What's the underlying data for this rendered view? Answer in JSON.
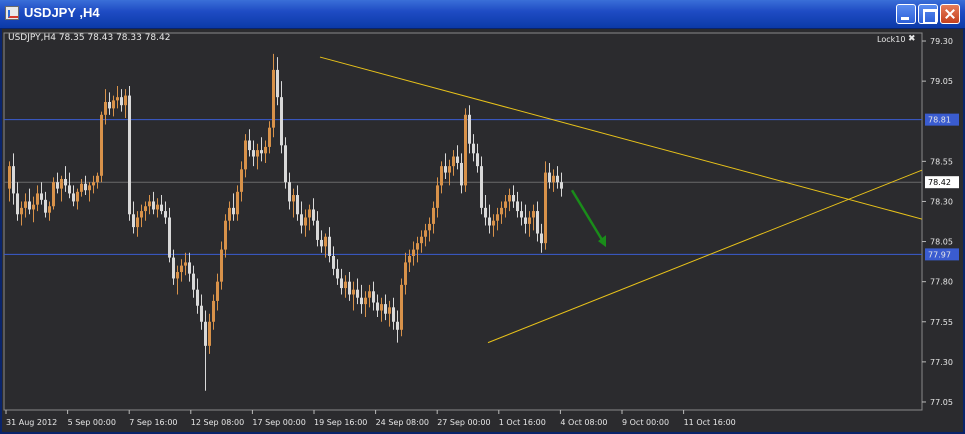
{
  "window": {
    "title": "USDJPY ,H4"
  },
  "chart_header": {
    "symbol_info": "USDJPY,H4  78.35 78.43 78.33 78.42",
    "lock_label": "Lock10",
    "lock_close_glyph": "✖"
  },
  "colors": {
    "background": "#2b2b2e",
    "grid": "#555560",
    "bull_candle": "#d8924a",
    "bear_candle": "#d9d9d9",
    "trendline": "#e8c21a",
    "hline": "#3a5cd0",
    "arrow": "#1a8c1a",
    "price_tag_bg": "#ffffff"
  },
  "chart_data": {
    "type": "candlestick",
    "symbol": "USDJPY",
    "timeframe": "H4",
    "ylim": [
      77.0,
      79.35
    ],
    "y_ticks": [
      "79.30",
      "79.05",
      "78.55",
      "78.30",
      "78.05",
      "77.80",
      "77.55",
      "77.30",
      "77.05"
    ],
    "x_tick_labels": [
      "31 Aug 2012",
      "5 Sep 00:00",
      "7 Sep 16:00",
      "12 Sep 08:00",
      "17 Sep 00:00",
      "19 Sep 16:00",
      "24 Sep 08:00",
      "27 Sep 00:00",
      "1 Oct 16:00",
      "4 Oct 08:00",
      "9 Oct 00:00",
      "11 Oct 16:00"
    ],
    "horizontal_lines": [
      {
        "price": 78.81,
        "label": "78.81"
      },
      {
        "price": 77.97,
        "label": "77.97"
      }
    ],
    "current_price": {
      "price": 78.42,
      "label": "78.42"
    },
    "trendlines": [
      {
        "name": "upper",
        "from": {
          "bar": 78,
          "price": 79.2
        },
        "to": {
          "bar": 230,
          "price": 78.18
        }
      },
      {
        "name": "lower",
        "from": {
          "bar": 120,
          "price": 77.42
        },
        "to": {
          "bar": 230,
          "price": 78.51
        }
      }
    ],
    "bars_count": 183,
    "bars_per_label": 15.4,
    "candles": [
      [
        78.38,
        78.55,
        78.3,
        78.52
      ],
      [
        78.52,
        78.6,
        78.28,
        78.35
      ],
      [
        78.35,
        78.42,
        78.18,
        78.22
      ],
      [
        78.22,
        78.3,
        78.15,
        78.26
      ],
      [
        78.26,
        78.35,
        78.2,
        78.3
      ],
      [
        78.3,
        78.38,
        78.22,
        78.25
      ],
      [
        78.25,
        78.33,
        78.17,
        78.28
      ],
      [
        78.28,
        78.4,
        78.24,
        78.35
      ],
      [
        78.35,
        78.42,
        78.28,
        78.31
      ],
      [
        78.31,
        78.36,
        78.2,
        78.23
      ],
      [
        78.23,
        78.3,
        78.18,
        78.27
      ],
      [
        78.27,
        78.45,
        78.25,
        78.42
      ],
      [
        78.42,
        78.48,
        78.35,
        78.38
      ],
      [
        78.38,
        78.46,
        78.3,
        78.44
      ],
      [
        78.44,
        78.52,
        78.36,
        78.4
      ],
      [
        78.4,
        78.48,
        78.32,
        78.35
      ],
      [
        78.35,
        78.4,
        78.27,
        78.3
      ],
      [
        78.3,
        78.38,
        78.25,
        78.36
      ],
      [
        78.36,
        78.44,
        78.33,
        78.41
      ],
      [
        78.41,
        78.46,
        78.34,
        78.37
      ],
      [
        78.37,
        78.42,
        78.3,
        78.4
      ],
      [
        78.4,
        78.46,
        78.35,
        78.42
      ],
      [
        78.42,
        78.48,
        78.38,
        78.46
      ],
      [
        78.46,
        78.86,
        78.42,
        78.84
      ],
      [
        78.84,
        79.0,
        78.78,
        78.92
      ],
      [
        78.92,
        78.98,
        78.84,
        78.88
      ],
      [
        78.88,
        78.96,
        78.83,
        78.93
      ],
      [
        78.93,
        79.02,
        78.88,
        78.95
      ],
      [
        78.95,
        79.0,
        78.86,
        78.9
      ],
      [
        78.9,
        79.0,
        78.82,
        78.96
      ],
      [
        78.96,
        79.02,
        78.18,
        78.22
      ],
      [
        78.22,
        78.3,
        78.1,
        78.14
      ],
      [
        78.14,
        78.24,
        78.08,
        78.2
      ],
      [
        78.2,
        78.28,
        78.14,
        78.24
      ],
      [
        78.24,
        78.3,
        78.18,
        78.27
      ],
      [
        78.27,
        78.34,
        78.22,
        78.3
      ],
      [
        78.3,
        78.36,
        78.22,
        78.25
      ],
      [
        78.25,
        78.32,
        78.2,
        78.28
      ],
      [
        78.28,
        78.34,
        78.22,
        78.24
      ],
      [
        78.24,
        78.3,
        78.16,
        78.2
      ],
      [
        78.2,
        78.26,
        77.92,
        77.95
      ],
      [
        77.95,
        78.0,
        77.78,
        77.82
      ],
      [
        77.82,
        77.9,
        77.72,
        77.86
      ],
      [
        77.86,
        77.94,
        77.8,
        77.9
      ],
      [
        77.9,
        77.98,
        77.84,
        77.92
      ],
      [
        77.92,
        77.98,
        77.8,
        77.85
      ],
      [
        77.85,
        77.9,
        77.7,
        77.75
      ],
      [
        77.75,
        77.82,
        77.6,
        77.65
      ],
      [
        77.65,
        77.72,
        77.5,
        77.55
      ],
      [
        77.55,
        77.62,
        77.12,
        77.4
      ],
      [
        77.4,
        77.6,
        77.35,
        77.55
      ],
      [
        77.55,
        77.72,
        77.5,
        77.68
      ],
      [
        77.68,
        77.85,
        77.62,
        77.8
      ],
      [
        77.8,
        78.05,
        77.75,
        78.0
      ],
      [
        78.0,
        78.22,
        77.95,
        78.18
      ],
      [
        78.18,
        78.3,
        78.12,
        78.26
      ],
      [
        78.26,
        78.35,
        78.18,
        78.22
      ],
      [
        78.22,
        78.4,
        78.18,
        78.36
      ],
      [
        78.36,
        78.55,
        78.3,
        78.5
      ],
      [
        78.5,
        78.72,
        78.45,
        78.68
      ],
      [
        78.68,
        78.75,
        78.58,
        78.62
      ],
      [
        78.62,
        78.68,
        78.52,
        78.58
      ],
      [
        78.58,
        78.66,
        78.5,
        78.62
      ],
      [
        78.62,
        78.7,
        78.55,
        78.6
      ],
      [
        78.6,
        78.68,
        78.54,
        78.64
      ],
      [
        78.64,
        78.8,
        78.6,
        78.76
      ],
      [
        78.76,
        79.22,
        78.7,
        79.12
      ],
      [
        79.12,
        79.2,
        78.9,
        78.95
      ],
      [
        78.95,
        79.05,
        78.6,
        78.65
      ],
      [
        78.65,
        78.7,
        78.38,
        78.42
      ],
      [
        78.42,
        78.48,
        78.25,
        78.3
      ],
      [
        78.3,
        78.38,
        78.2,
        78.34
      ],
      [
        78.34,
        78.4,
        78.18,
        78.22
      ],
      [
        78.22,
        78.3,
        78.1,
        78.15
      ],
      [
        78.15,
        78.25,
        78.08,
        78.2
      ],
      [
        78.2,
        78.28,
        78.12,
        78.25
      ],
      [
        78.25,
        78.32,
        78.15,
        78.18
      ],
      [
        78.18,
        78.24,
        78.02,
        78.06
      ],
      [
        78.06,
        78.12,
        77.98,
        78.02
      ],
      [
        78.02,
        78.1,
        77.95,
        78.08
      ],
      [
        78.08,
        78.14,
        77.92,
        77.96
      ],
      [
        77.96,
        78.02,
        77.84,
        77.88
      ],
      [
        77.88,
        77.94,
        77.78,
        77.82
      ],
      [
        77.82,
        77.88,
        77.72,
        77.76
      ],
      [
        77.76,
        77.84,
        77.7,
        77.8
      ],
      [
        77.8,
        77.86,
        77.68,
        77.72
      ],
      [
        77.72,
        77.8,
        77.62,
        77.75
      ],
      [
        77.75,
        77.82,
        77.66,
        77.7
      ],
      [
        77.7,
        77.78,
        77.6,
        77.66
      ],
      [
        77.66,
        77.74,
        77.58,
        77.7
      ],
      [
        77.7,
        77.78,
        77.64,
        77.74
      ],
      [
        77.74,
        77.8,
        77.62,
        77.67
      ],
      [
        77.67,
        77.72,
        77.58,
        77.62
      ],
      [
        77.62,
        77.7,
        77.55,
        77.66
      ],
      [
        77.66,
        77.72,
        77.56,
        77.6
      ],
      [
        77.6,
        77.68,
        77.52,
        77.64
      ],
      [
        77.64,
        77.7,
        77.5,
        77.55
      ],
      [
        77.55,
        77.62,
        77.42,
        77.5
      ],
      [
        77.5,
        77.82,
        77.46,
        77.78
      ],
      [
        77.78,
        77.98,
        77.72,
        77.92
      ],
      [
        77.92,
        78.0,
        77.86,
        77.96
      ],
      [
        77.96,
        78.05,
        77.9,
        78.0
      ],
      [
        78.0,
        78.08,
        77.92,
        78.04
      ],
      [
        78.04,
        78.12,
        77.98,
        78.08
      ],
      [
        78.08,
        78.16,
        78.02,
        78.12
      ],
      [
        78.12,
        78.2,
        78.05,
        78.16
      ],
      [
        78.16,
        78.3,
        78.1,
        78.26
      ],
      [
        78.26,
        78.45,
        78.2,
        78.4
      ],
      [
        78.4,
        78.55,
        78.35,
        78.52
      ],
      [
        78.52,
        78.6,
        78.44,
        78.48
      ],
      [
        78.48,
        78.56,
        78.4,
        78.52
      ],
      [
        78.52,
        78.62,
        78.46,
        78.58
      ],
      [
        78.58,
        78.65,
        78.5,
        78.54
      ],
      [
        78.54,
        78.6,
        78.35,
        78.4
      ],
      [
        78.4,
        78.88,
        78.36,
        78.84
      ],
      [
        78.84,
        78.9,
        78.6,
        78.66
      ],
      [
        78.66,
        78.72,
        78.55,
        78.6
      ],
      [
        78.6,
        78.66,
        78.48,
        78.52
      ],
      [
        78.52,
        78.58,
        78.22,
        78.26
      ],
      [
        78.26,
        78.34,
        78.15,
        78.2
      ],
      [
        78.2,
        78.28,
        78.1,
        78.15
      ],
      [
        78.15,
        78.22,
        78.08,
        78.18
      ],
      [
        78.18,
        78.26,
        78.12,
        78.22
      ],
      [
        78.22,
        78.3,
        78.16,
        78.26
      ],
      [
        78.26,
        78.34,
        78.2,
        78.3
      ],
      [
        78.3,
        78.38,
        78.24,
        78.34
      ],
      [
        78.34,
        78.4,
        78.26,
        78.3
      ],
      [
        78.3,
        78.36,
        78.2,
        78.24
      ],
      [
        78.24,
        78.3,
        78.15,
        78.2
      ],
      [
        78.2,
        78.28,
        78.1,
        78.16
      ],
      [
        78.16,
        78.24,
        78.08,
        78.2
      ],
      [
        78.2,
        78.28,
        78.12,
        78.24
      ],
      [
        78.24,
        78.3,
        78.05,
        78.1
      ],
      [
        78.1,
        78.16,
        77.98,
        78.04
      ],
      [
        78.04,
        78.55,
        78.0,
        78.48
      ],
      [
        78.48,
        78.54,
        78.38,
        78.42
      ],
      [
        78.42,
        78.5,
        78.36,
        78.46
      ],
      [
        78.46,
        78.52,
        78.38,
        78.42
      ],
      [
        78.42,
        78.48,
        78.33,
        78.38
      ]
    ]
  }
}
